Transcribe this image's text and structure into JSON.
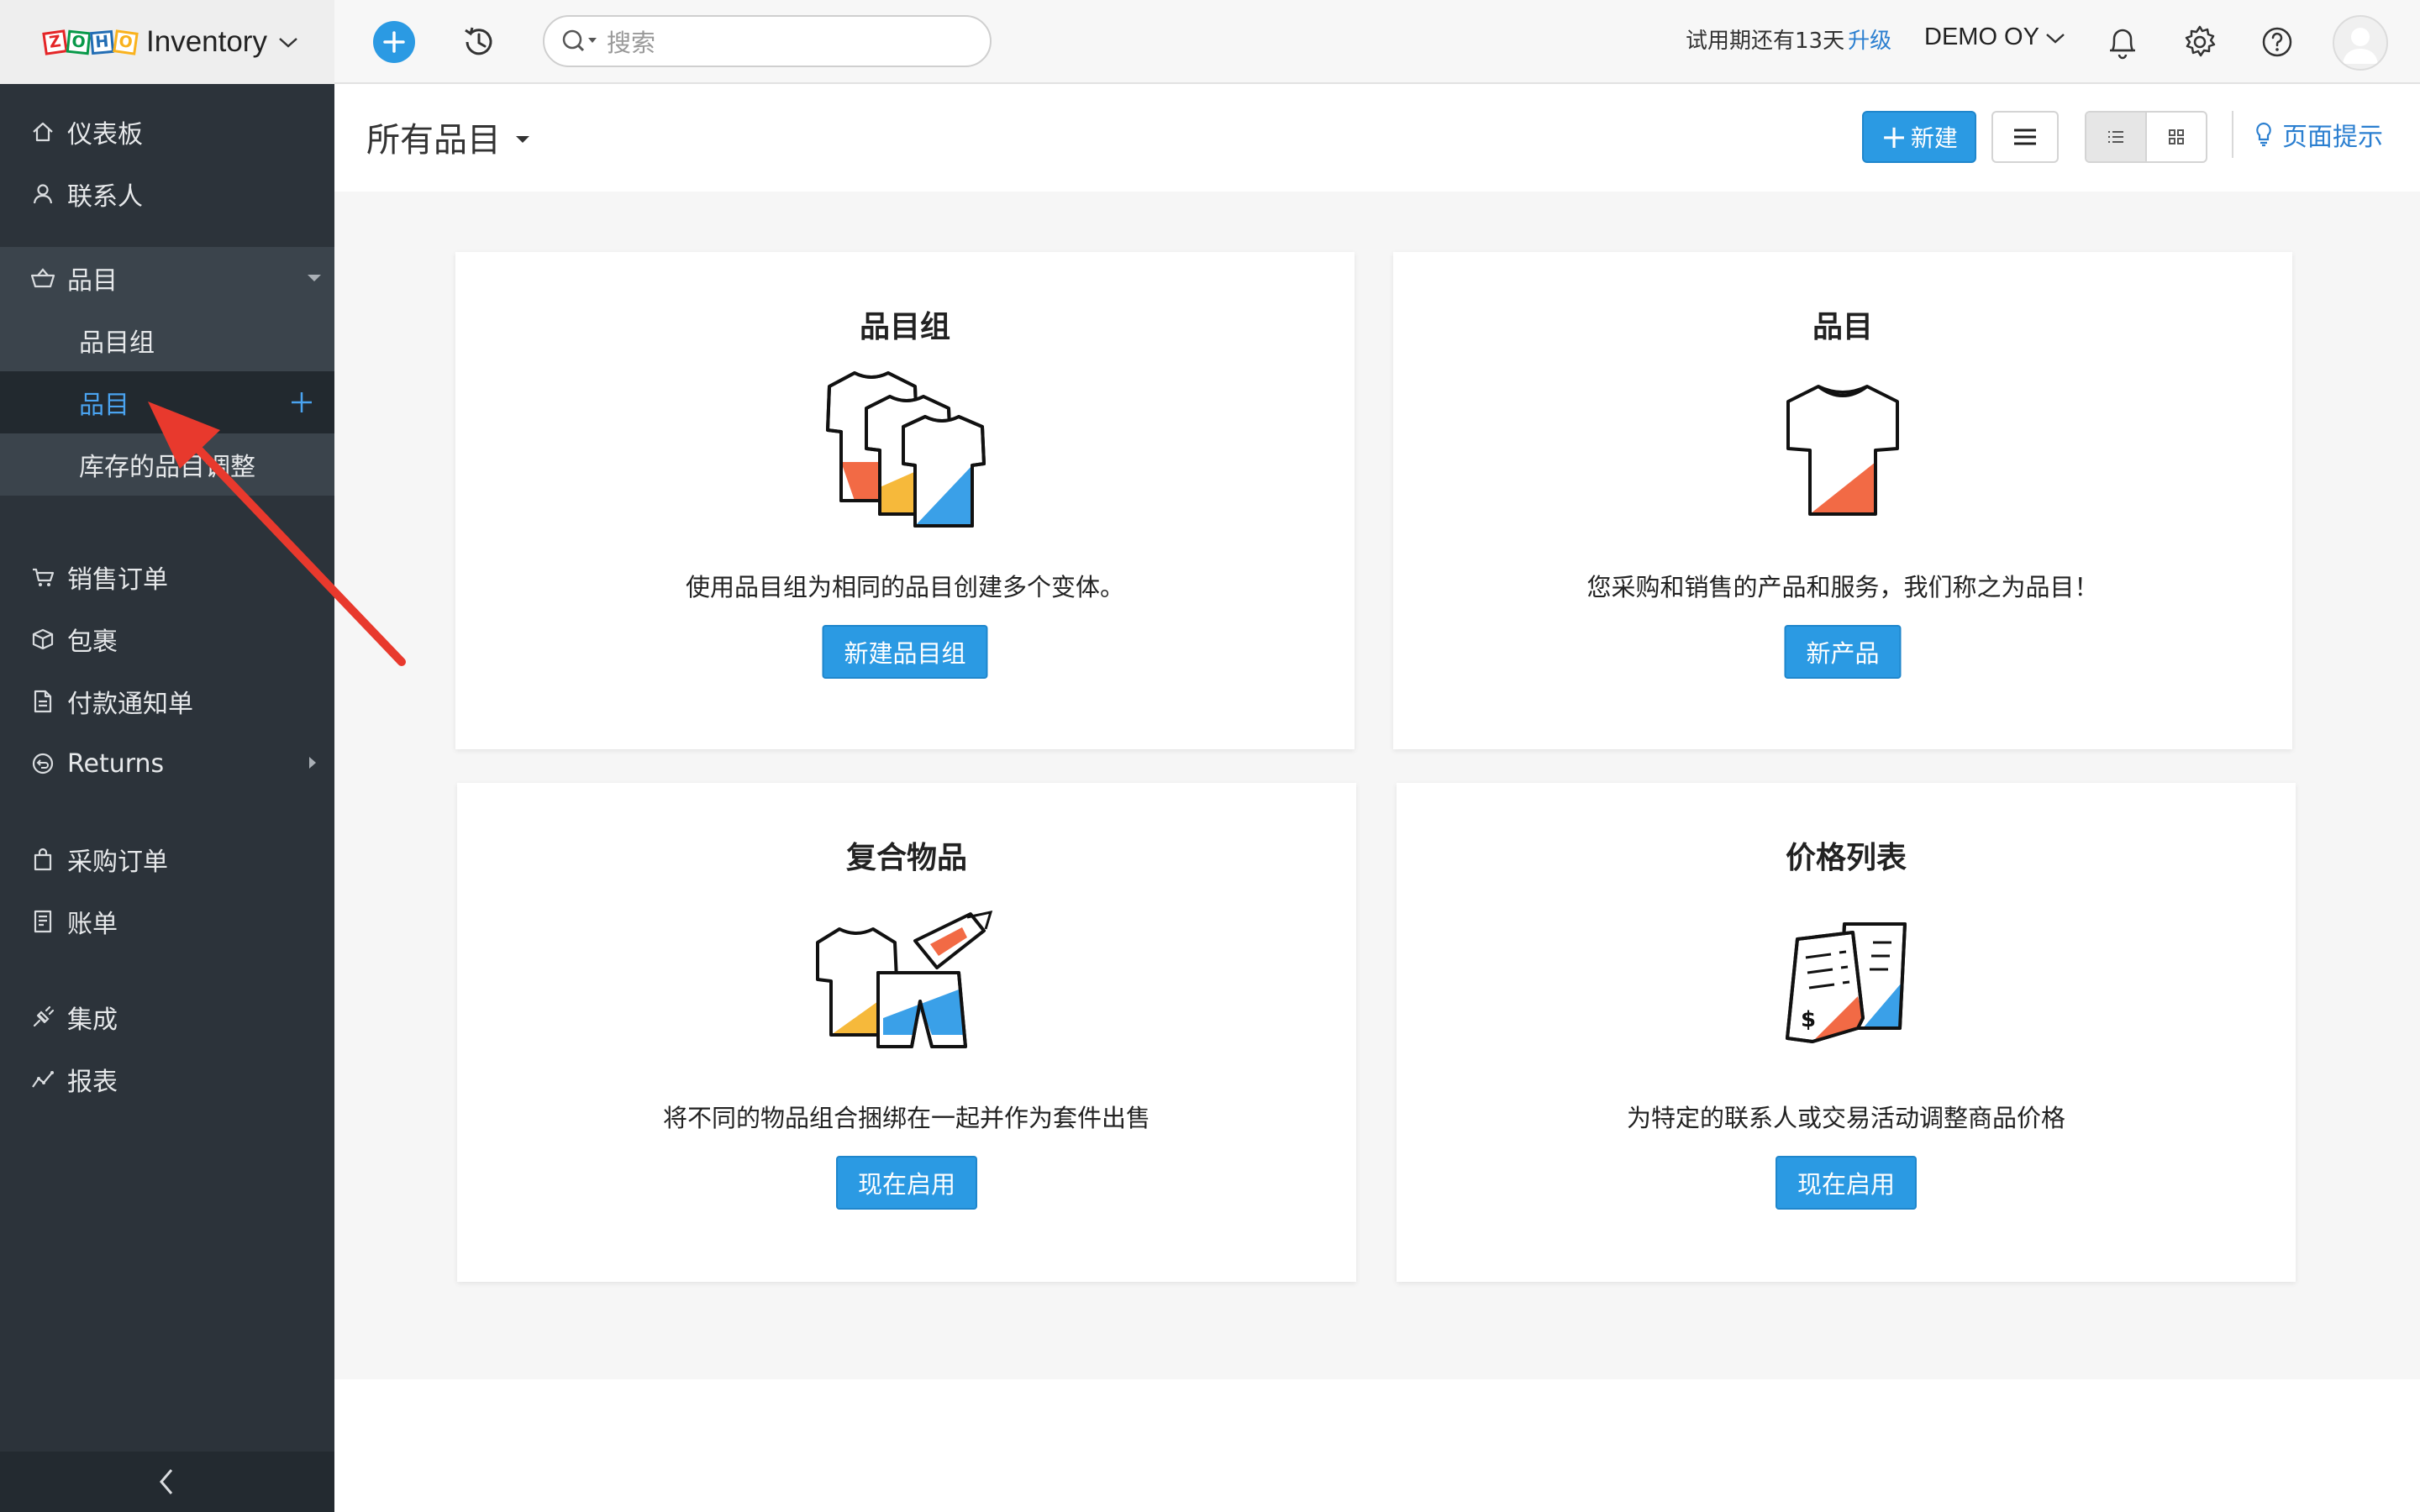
{
  "app": {
    "brand_name": "Inventory",
    "logo_letters": [
      "Z",
      "O",
      "H",
      "O"
    ]
  },
  "topbar": {
    "search_placeholder": "搜索",
    "trial_text": "试用期还有13天",
    "upgrade_label": "升级",
    "org_name": "DEMO OY",
    "icons": [
      "plus-icon",
      "history-icon",
      "search-icon",
      "bell-icon",
      "gear-icon",
      "help-icon",
      "avatar"
    ]
  },
  "sidebar": {
    "items": [
      {
        "label": "仪表板",
        "icon": "home-icon"
      },
      {
        "label": "联系人",
        "icon": "user-icon"
      },
      {
        "label": "品目",
        "icon": "basket-icon"
      },
      {
        "label": "品目组"
      },
      {
        "label": "品目"
      },
      {
        "label": "库存的品目调整"
      },
      {
        "label": "销售订单",
        "icon": "cart-icon"
      },
      {
        "label": "包裹",
        "icon": "package-icon"
      },
      {
        "label": "付款通知单",
        "icon": "document-icon"
      },
      {
        "label": "Returns",
        "icon": "returns-icon"
      },
      {
        "label": "采购订单",
        "icon": "bag-icon"
      },
      {
        "label": "账单",
        "icon": "bill-icon"
      },
      {
        "label": "集成",
        "icon": "integration-icon"
      },
      {
        "label": "报表",
        "icon": "chart-icon"
      }
    ]
  },
  "header": {
    "title": "所有品目",
    "new_button": "新建",
    "page_tip": "页面提示"
  },
  "cards": [
    {
      "title": "品目组",
      "description": "使用品目组为相同的品目创建多个变体。",
      "button": "新建品目组"
    },
    {
      "title": "品目",
      "description": "您采购和销售的产品和服务，我们称之为品目！",
      "button": "新产品"
    },
    {
      "title": "复合物品",
      "description": "将不同的物品组合捆绑在一起并作为套件出售",
      "button": "现在启用"
    },
    {
      "title": "价格列表",
      "description": "为特定的联系人或交易活动调整商品价格",
      "button": "现在启用"
    }
  ],
  "colors": {
    "accent": "#2b9ae3",
    "sidebar_bg": "#2c333a",
    "active_link": "#4aa3f0",
    "annotation_arrow": "#e8392d",
    "shirt_orange": "#f26a45",
    "shirt_yellow": "#f6b93b",
    "shirt_blue": "#3aa0e8"
  }
}
